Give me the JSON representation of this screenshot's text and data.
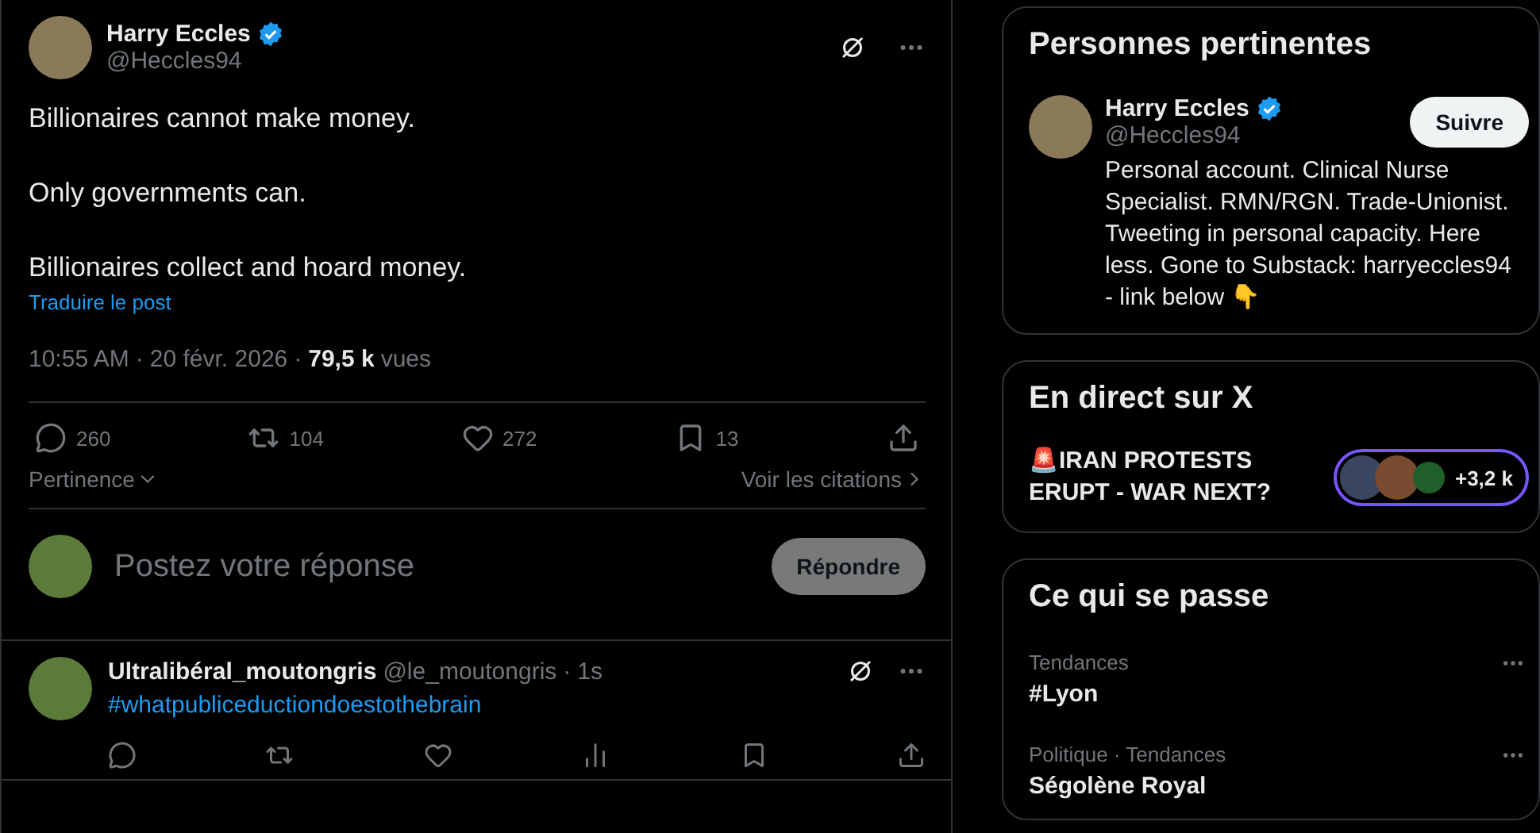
{
  "tweet": {
    "author": {
      "name": "Harry Eccles",
      "handle": "@Heccles94",
      "verified": true
    },
    "body": [
      "Billionaires cannot make money.",
      "Only governments can.",
      "Billionaires collect and hoard money."
    ],
    "translate": "Traduire le post",
    "meta": {
      "time": "10:55 AM",
      "date": "20 févr. 2026",
      "views_count": "79,5 k",
      "views_label": "vues",
      "separator": "·"
    },
    "actions": [
      {
        "kind": "reply",
        "count": "260"
      },
      {
        "kind": "repost",
        "count": "104"
      },
      {
        "kind": "like",
        "count": "272"
      },
      {
        "kind": "bookmark",
        "count": "13"
      },
      {
        "kind": "share"
      }
    ],
    "sort": "Pertinence",
    "quotes": "Voir les citations",
    "composer": {
      "placeholder": "Postez votre réponse",
      "button": "Répondre",
      "disabled": true
    }
  },
  "replies": [
    {
      "name": "Ultralibéral_moutongris",
      "handle": "@le_moutongris",
      "separator": "·",
      "time": "1s",
      "text": "#whatpubliceductiondoestothebrain",
      "actions": [
        {
          "kind": "reply"
        },
        {
          "kind": "repost"
        },
        {
          "kind": "like"
        },
        {
          "kind": "views"
        },
        {
          "kind": "bookmark"
        },
        {
          "kind": "share"
        }
      ]
    }
  ],
  "sidebar": {
    "relevant": {
      "title": "Personnes pertinentes",
      "name": "Harry Eccles",
      "handle": "@Heccles94",
      "verified": true,
      "follow": "Suivre",
      "bio": "Personal account. Clinical Nurse Specialist. RMN/RGN. Trade-Unionist. Tweeting in personal capacity. Here less. Gone to Substack: harryeccles94 - link below 👇"
    },
    "live": {
      "title": "En direct sur X",
      "event": "🚨IRAN PROTESTS ERUPT - WAR NEXT?",
      "listeners": "+3,2 k"
    },
    "trends": {
      "title": "Ce qui se passe",
      "items": [
        {
          "category": "Tendances",
          "title": "#Lyon"
        },
        {
          "category": "Politique · Tendances",
          "title": "Ségolène Royal"
        }
      ]
    }
  }
}
